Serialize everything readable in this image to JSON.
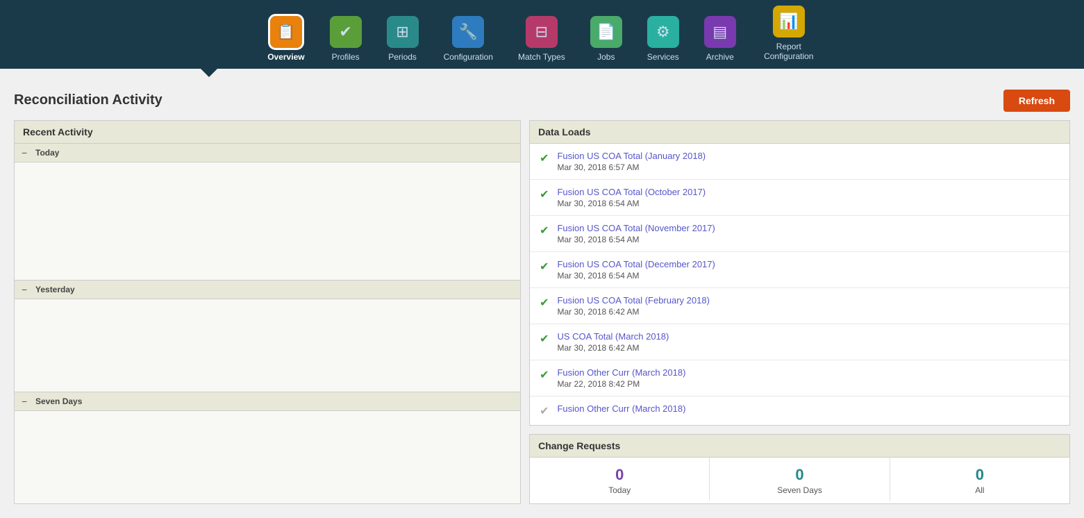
{
  "nav": {
    "items": [
      {
        "id": "overview",
        "label": "Overview",
        "icon": "📋",
        "color": "orange",
        "active": true
      },
      {
        "id": "profiles",
        "label": "Profiles",
        "icon": "✅",
        "color": "green",
        "active": false
      },
      {
        "id": "periods",
        "label": "Periods",
        "icon": "▦",
        "color": "teal",
        "active": false
      },
      {
        "id": "configuration",
        "label": "Configuration",
        "icon": "🔧",
        "color": "blue",
        "active": false
      },
      {
        "id": "match-types",
        "label": "Match Types",
        "icon": "⊞",
        "color": "pink",
        "active": false
      },
      {
        "id": "jobs",
        "label": "Jobs",
        "icon": "📄",
        "color": "jobs",
        "active": false
      },
      {
        "id": "services",
        "label": "Services",
        "icon": "⚙",
        "color": "services",
        "active": false
      },
      {
        "id": "archive",
        "label": "Archive",
        "icon": "▤",
        "color": "archive",
        "active": false
      },
      {
        "id": "report-config",
        "label": "Report Configuration",
        "icon": "📊",
        "color": "report",
        "active": false
      }
    ]
  },
  "page": {
    "title": "Reconciliation Activity",
    "refresh_button": "Refresh"
  },
  "recent_activity": {
    "header": "Recent Activity",
    "sections": [
      {
        "id": "today",
        "label": "Today",
        "collapsed": false
      },
      {
        "id": "yesterday",
        "label": "Yesterday",
        "collapsed": false
      },
      {
        "id": "seven_days",
        "label": "Seven Days",
        "collapsed": false
      }
    ]
  },
  "data_loads": {
    "header": "Data Loads",
    "items": [
      {
        "name": "Fusion US COA Total (January 2018)",
        "date": "Mar 30, 2018 6:57 AM",
        "status": "success"
      },
      {
        "name": "Fusion US COA Total (October 2017)",
        "date": "Mar 30, 2018 6:54 AM",
        "status": "success"
      },
      {
        "name": "Fusion US COA Total (November 2017)",
        "date": "Mar 30, 2018 6:54 AM",
        "status": "success"
      },
      {
        "name": "Fusion US COA Total (December 2017)",
        "date": "Mar 30, 2018 6:54 AM",
        "status": "success"
      },
      {
        "name": "Fusion US COA Total (February 2018)",
        "date": "Mar 30, 2018 6:42 AM",
        "status": "success"
      },
      {
        "name": "US COA Total (March 2018)",
        "date": "Mar 30, 2018 6:42 AM",
        "status": "success"
      },
      {
        "name": "Fusion Other Curr (March 2018)",
        "date": "Mar 22, 2018 8:42 PM",
        "status": "success"
      },
      {
        "name": "Fusion Other Curr (March 2018)",
        "date": "",
        "status": "pending"
      }
    ]
  },
  "change_requests": {
    "header": "Change Requests",
    "stats": [
      {
        "id": "today",
        "value": "0",
        "label": "Today",
        "color": "purple"
      },
      {
        "id": "seven_days",
        "value": "0",
        "label": "Seven Days",
        "color": "teal-num"
      },
      {
        "id": "all",
        "value": "0",
        "label": "All",
        "color": "teal-num"
      }
    ]
  }
}
